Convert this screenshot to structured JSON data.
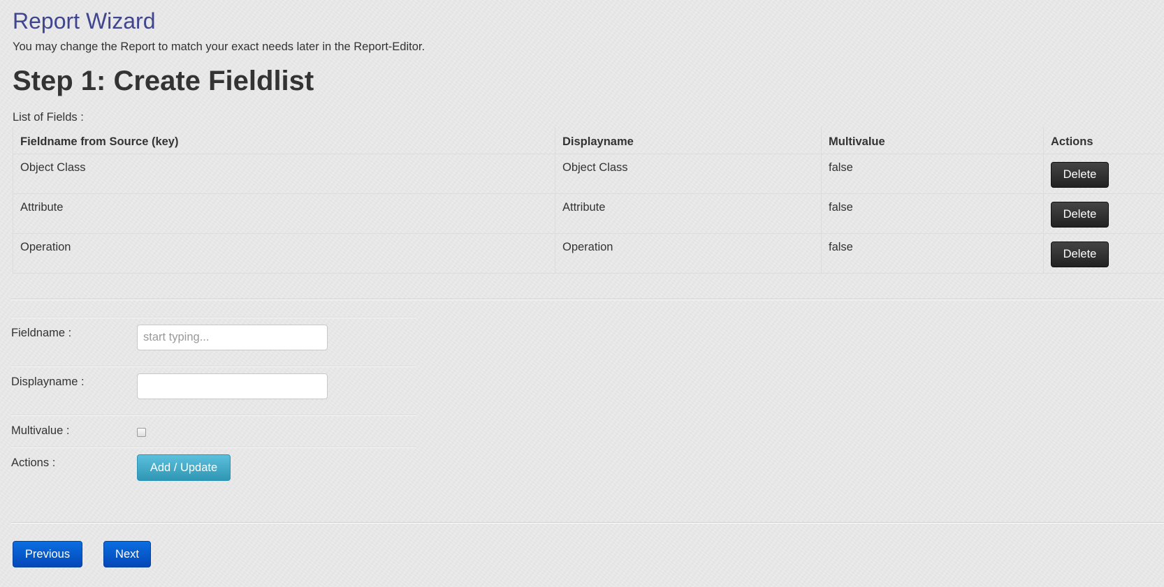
{
  "wizard": {
    "title": "Report Wizard",
    "intro": "You may change the Report to match your exact needs later in the Report-Editor.",
    "step_title": "Step 1: Create Fieldlist"
  },
  "field_list": {
    "label": "List of Fields :",
    "columns": [
      "Fieldname from Source (key)",
      "Displayname",
      "Multivalue",
      "Actions"
    ],
    "rows": [
      {
        "fieldname": "Object Class",
        "displayname": "Object Class",
        "multivalue": "false",
        "action": "Delete"
      },
      {
        "fieldname": "Attribute",
        "displayname": "Attribute",
        "multivalue": "false",
        "action": "Delete"
      },
      {
        "fieldname": "Operation",
        "displayname": "Operation",
        "multivalue": "false",
        "action": "Delete"
      }
    ]
  },
  "form": {
    "fieldname_label": "Fieldname :",
    "fieldname_placeholder": "start typing...",
    "fieldname_value": "",
    "displayname_label": "Displayname :",
    "displayname_value": "",
    "multivalue_label": "Multivalue :",
    "multivalue_checked": false,
    "actions_label": "Actions :",
    "add_update_label": "Add / Update"
  },
  "nav": {
    "previous_label": "Previous",
    "next_label": "Next"
  },
  "colors": {
    "title": "#3f458e",
    "delete_button": "#2b2b2b",
    "add_update_button": "#49afcd",
    "nav_button": "#0a5fd4"
  }
}
